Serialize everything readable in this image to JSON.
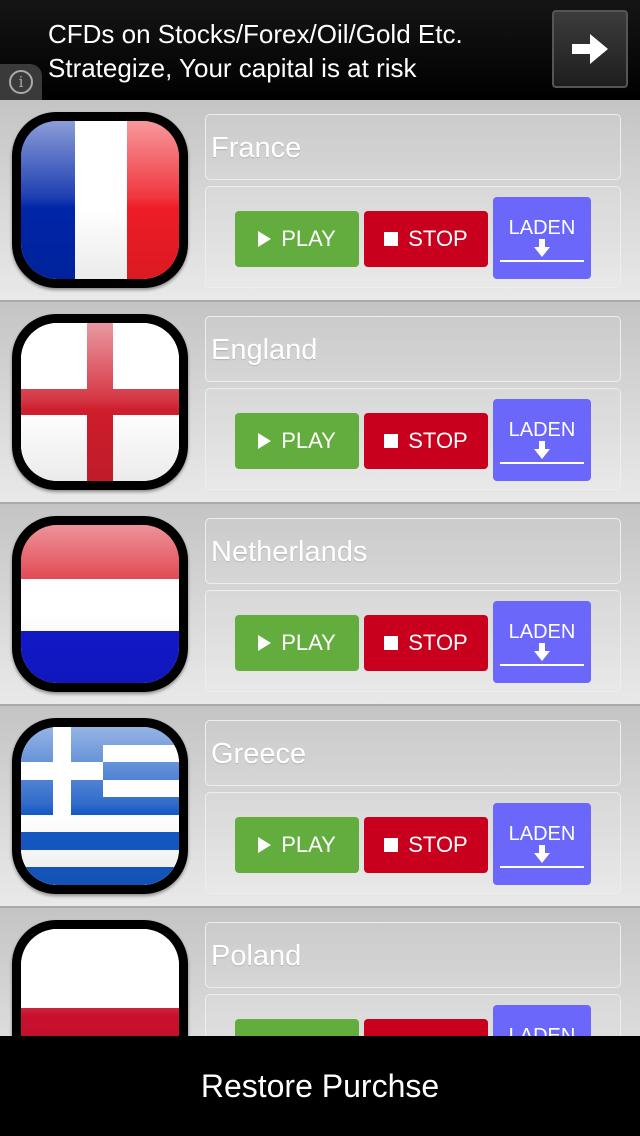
{
  "ad": {
    "line1": "CFDs on Stocks/Forex/Oil/Gold Etc.",
    "line2": "Strategize, Your capital is at risk",
    "info_glyph": "i",
    "info_icon": "info-icon",
    "arrow_icon": "arrow-right-icon"
  },
  "countries": [
    {
      "name": "France",
      "flag": "france-flag"
    },
    {
      "name": "England",
      "flag": "england-flag"
    },
    {
      "name": "Netherlands",
      "flag": "netherlands-flag"
    },
    {
      "name": "Greece",
      "flag": "greece-flag"
    },
    {
      "name": "Poland",
      "flag": "poland-flag"
    }
  ],
  "buttons": {
    "play": "PLAY",
    "stop": "STOP",
    "load": "LADEN"
  },
  "colors": {
    "play": "#62ad3e",
    "stop": "#c8001e",
    "load": "#6b67fa"
  },
  "footer": {
    "restore_label": "Restore Purchse"
  }
}
